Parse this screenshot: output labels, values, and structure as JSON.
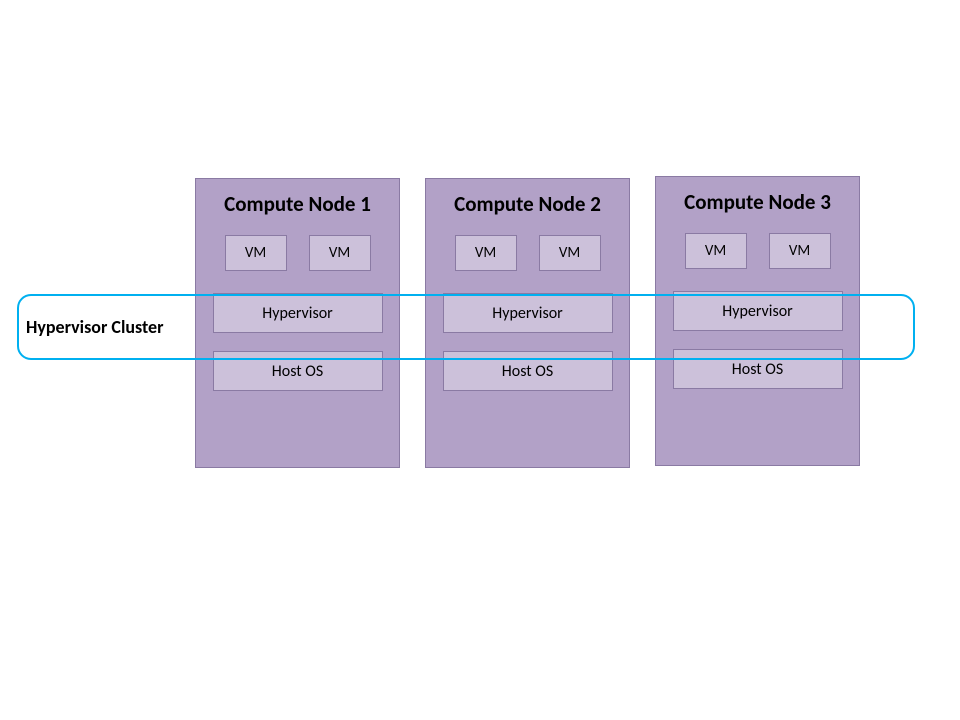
{
  "cluster_label": "Hypervisor Cluster",
  "nodes": [
    {
      "title": "Compute Node 1",
      "vm1": "VM",
      "vm2": "VM",
      "hypervisor": "Hypervisor",
      "hostos": "Host OS"
    },
    {
      "title": "Compute Node 2",
      "vm1": "VM",
      "vm2": "VM",
      "hypervisor": "Hypervisor",
      "hostos": "Host OS"
    },
    {
      "title": "Compute Node 3",
      "vm1": "VM",
      "vm2": "VM",
      "hypervisor": "Hypervisor",
      "hostos": "Host OS"
    }
  ]
}
